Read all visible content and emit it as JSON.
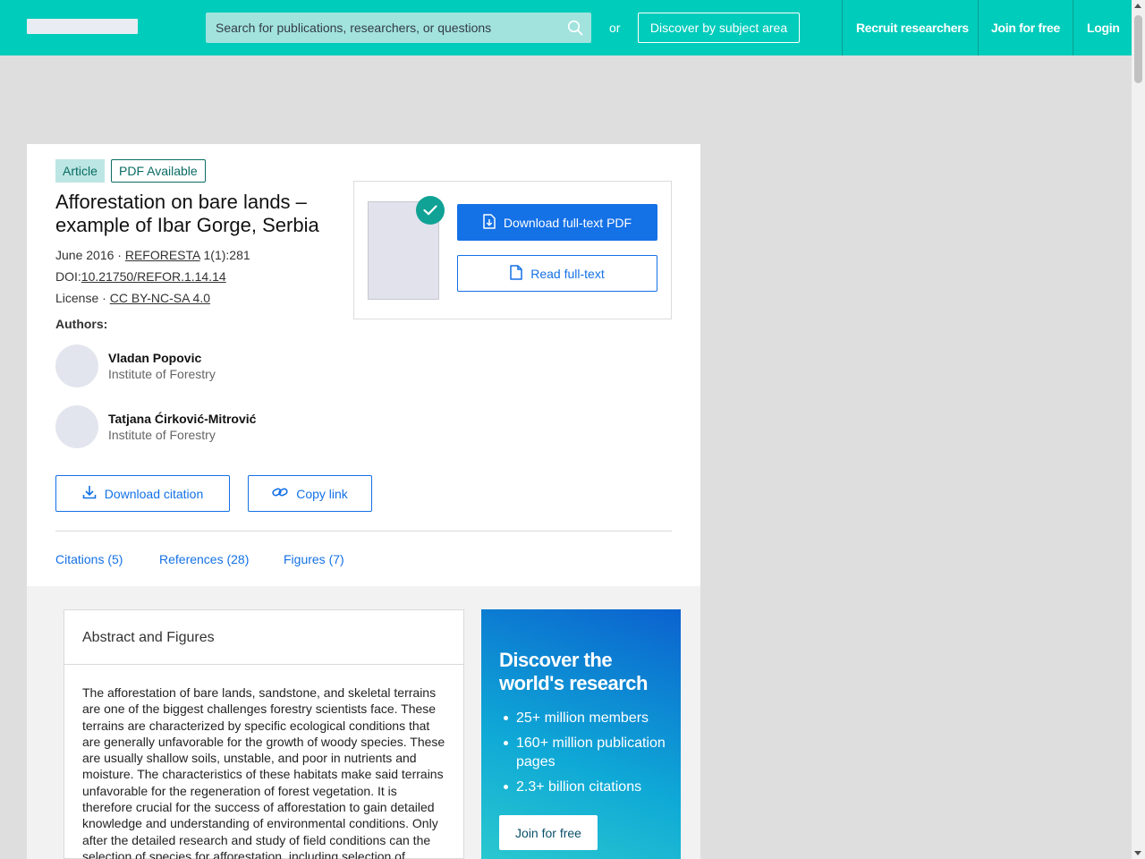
{
  "header": {
    "search_placeholder": "Search for publications, researchers, or questions",
    "or_text": "or",
    "discover_label": "Discover by subject area",
    "nav": {
      "recruit": "Recruit researchers",
      "join": "Join for free",
      "login": "Login"
    }
  },
  "article": {
    "type_badge": "Article",
    "pdf_badge": "PDF Available",
    "title": "Afforestation on bare lands – example of Ibar Gorge, Serbia",
    "date": "June 2016 · ",
    "journal": "REFORESTA",
    "volume": " 1(1):281",
    "doi_label": "DOI:",
    "doi": "10.21750/REFOR.1.14.14",
    "license_label": "License · ",
    "license": "CC BY-NC-SA 4.0",
    "authors_label": "Authors:",
    "authors": [
      {
        "name": "Vladan Popovic",
        "institution": "Institute of Forestry"
      },
      {
        "name": "Tatjana Ćirković-Mitrović",
        "institution": "Institute of Forestry"
      }
    ]
  },
  "actions": {
    "download_pdf": "Download full-text PDF",
    "read_fulltext": "Read full-text",
    "download_citation": "Download citation",
    "copy_link": "Copy link"
  },
  "tabs": [
    {
      "label": "Citations (5)"
    },
    {
      "label": "References (28)"
    },
    {
      "label": "Figures (7)"
    }
  ],
  "abstract": {
    "heading": "Abstract and Figures",
    "text": "The afforestation of bare lands, sandstone, and skeletal terrains are one of the biggest challenges forestry scientists face. These terrains are characterized by specific ecological conditions that are generally unfavorable for the growth of woody species. These are usually shallow soils, unstable, and poor in nutrients and moisture. The characteristics of these habitats make said terrains unfavorable for the regeneration of forest vegetation. It is therefore crucial for the success of afforestation to gain detailed knowledge and understanding of environmental conditions. Only after the detailed research and study of field conditions can the selection of species for afforestation, including selection of"
  },
  "promo": {
    "title": "Discover the world's research",
    "items": [
      "25+ million members",
      "160+ million publication pages",
      "2.3+ billion citations"
    ],
    "button": "Join for free"
  },
  "colors": {
    "brand_teal": "#00ccbb",
    "primary_blue": "#1471e6",
    "check_green": "#0fa295"
  }
}
